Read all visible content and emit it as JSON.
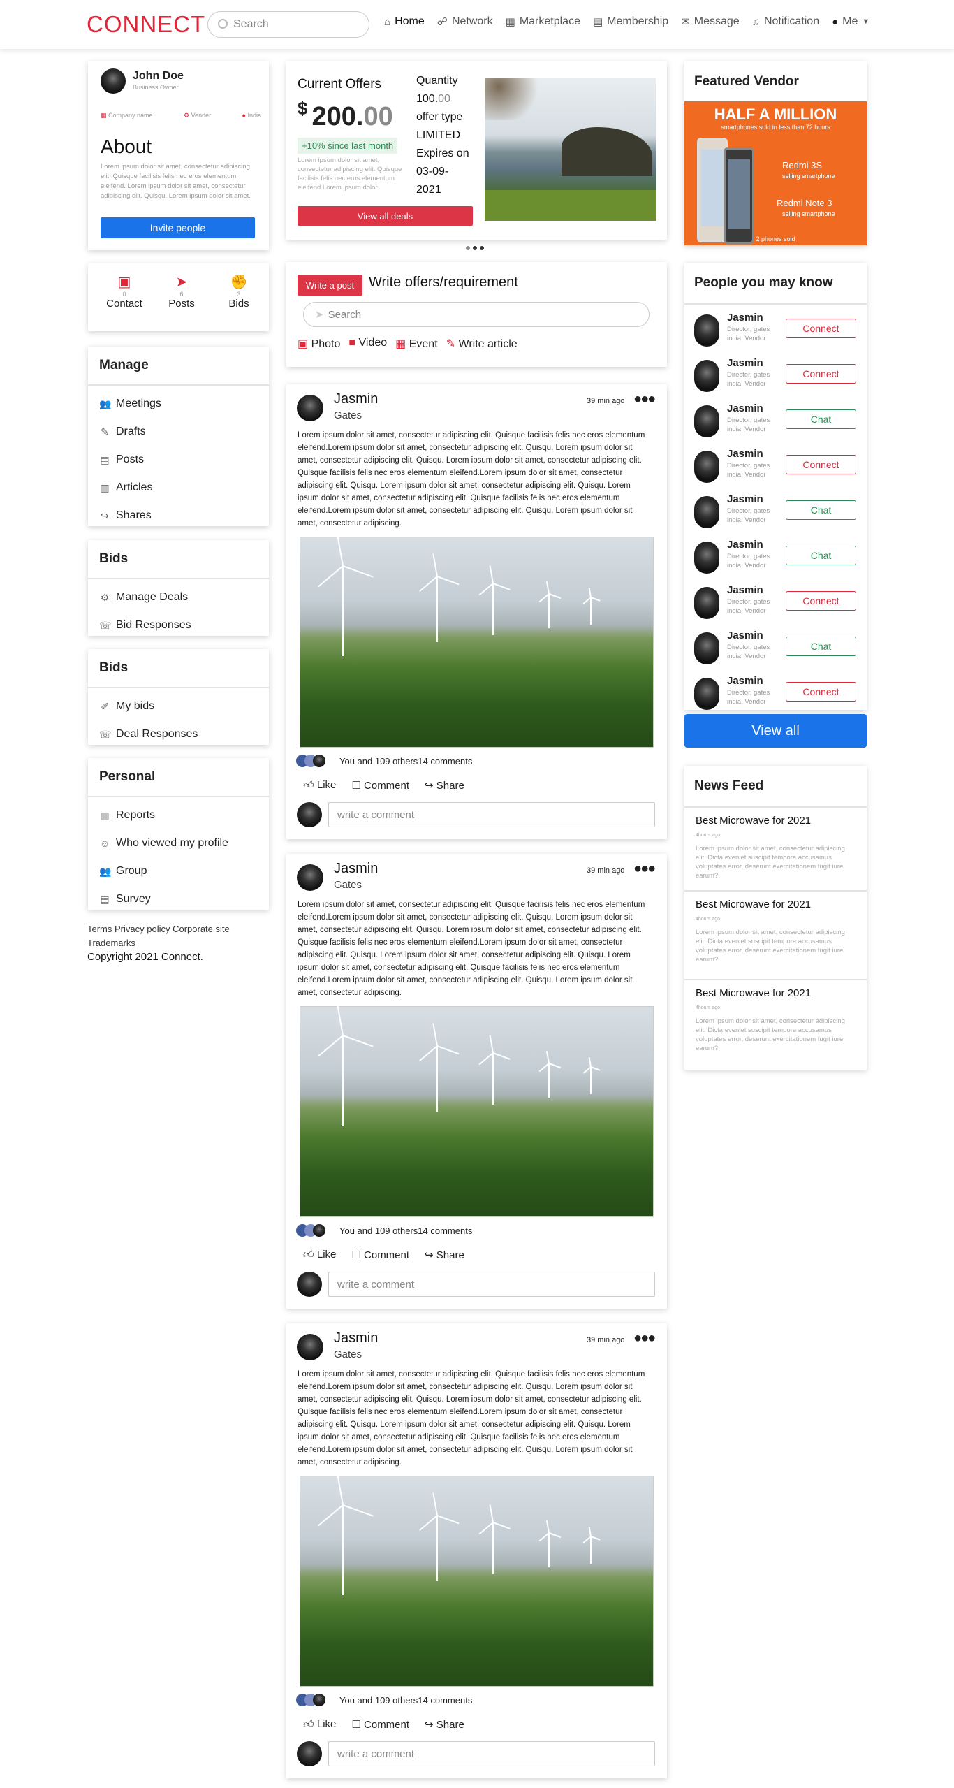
{
  "app": {
    "logo": "CONNECT",
    "search_placeholder": "Search"
  },
  "nav": [
    {
      "label": "Home",
      "icon": "home-icon",
      "glyph": "⌂"
    },
    {
      "label": "Network",
      "icon": "network-icon",
      "glyph": "☍"
    },
    {
      "label": "Marketplace",
      "icon": "marketplace-icon",
      "glyph": "▦"
    },
    {
      "label": "Membership",
      "icon": "membership-icon",
      "glyph": "▤"
    },
    {
      "label": "Message",
      "icon": "message-icon",
      "glyph": "✉"
    },
    {
      "label": "Notification",
      "icon": "bell-icon",
      "glyph": "♫"
    },
    {
      "label": "Me",
      "icon": "avatar-icon",
      "glyph": "●"
    }
  ],
  "profile": {
    "name": "John Doe",
    "role": "Business Owner",
    "meta": [
      "Company name",
      "Vender",
      "India"
    ],
    "about_title": "About",
    "about_text": "Lorem ipsum dolor sit amet, consectetur adipiscing elit. Quisque facilisis felis nec eros elementum eleifend. Lorem ipsum dolor sit amet, consectetur adipiscing elit. Quisqu. Lorem ipsum dolor sit amet.",
    "invite_label": "Invite people"
  },
  "stats": [
    {
      "count": "0",
      "label": "Contact"
    },
    {
      "count": "6",
      "label": "Posts"
    },
    {
      "count": "3",
      "label": "Bids"
    }
  ],
  "menus": [
    {
      "title": "Manage",
      "items": [
        {
          "label": "Meetings",
          "glyph": "👥"
        },
        {
          "label": "Drafts",
          "glyph": "✎"
        },
        {
          "label": "Posts",
          "glyph": "▤"
        },
        {
          "label": "Articles",
          "glyph": "▥"
        },
        {
          "label": "Shares",
          "glyph": "↪"
        }
      ]
    },
    {
      "title": "Bids",
      "items": [
        {
          "label": "Manage Deals",
          "glyph": "⚙"
        },
        {
          "label": "Bid Responses",
          "glyph": "☏"
        }
      ]
    },
    {
      "title": "Bids",
      "items": [
        {
          "label": "My bids",
          "glyph": "✐"
        },
        {
          "label": "Deal Responses",
          "glyph": "☏"
        }
      ]
    },
    {
      "title": "Personal",
      "items": [
        {
          "label": "Reports",
          "glyph": "▥"
        },
        {
          "label": "Who viewed my profile",
          "glyph": "☺"
        },
        {
          "label": "Group",
          "glyph": "👥"
        },
        {
          "label": "Survey",
          "glyph": "▤"
        }
      ]
    }
  ],
  "footer": {
    "links": "Terms Privacy policy Corporate site",
    "links2": "Trademarks",
    "copyright": "Copyright 2021 Connect."
  },
  "offers": {
    "title": "Current Offers",
    "currency": "$",
    "amount_main": "200.",
    "amount_cents": "00",
    "growth": "+10% since last month",
    "desc": "Lorem ipsum dolor sit amet, consectetur adipiscing elit. Quisque facilisis felis nec eros elementum eleifend.Lorem ipsum dolor",
    "button": "View all deals",
    "quantity_label": "Quantity",
    "quantity_main": "100.",
    "quantity_cents": "00",
    "offer_type_label": "offer type",
    "offer_type": "LIMITED",
    "expires_label": "Expires on",
    "expires": "03-09-2021"
  },
  "composer": {
    "write_post": "Write a post",
    "heading": "Write offers/requirement",
    "search_placeholder": "Search",
    "actions": [
      "Photo",
      "Video",
      "Event",
      "Write article"
    ]
  },
  "posts": [
    {
      "name": "Jasmin",
      "sub": "Gates",
      "time": "39 min ago",
      "reactions": "You and 109 others",
      "comments": "14 comments"
    },
    {
      "name": "Jasmin",
      "sub": "Gates",
      "time": "39 min ago",
      "reactions": "You and 109 others",
      "comments": "14 comments"
    },
    {
      "name": "Jasmin",
      "sub": "Gates",
      "time": "39 min ago",
      "reactions": "You and 109 others",
      "comments": "14 comments"
    }
  ],
  "post_body": "Lorem ipsum dolor sit amet, consectetur adipiscing elit. Quisque facilisis felis nec eros elementum eleifend.Lorem ipsum dolor sit amet, consectetur adipiscing elit. Quisqu. Lorem ipsum dolor sit amet, consectetur adipiscing elit. Quisqu. Lorem ipsum dolor sit amet, consectetur adipiscing elit. Quisque facilisis felis nec eros elementum eleifend.Lorem ipsum dolor sit amet, consectetur adipiscing elit. Quisqu. Lorem ipsum dolor sit amet, consectetur adipiscing elit. Quisqu. Lorem ipsum dolor sit amet, consectetur adipiscing elit. Quisque facilisis felis nec eros elementum eleifend.Lorem ipsum dolor sit amet, consectetur adipiscing elit. Quisqu. Lorem ipsum dolor sit amet, consectetur adipiscing.",
  "post_actions": {
    "like": "Like",
    "comment": "Comment",
    "share": "Share",
    "comment_placeholder": "write a comment"
  },
  "vendor": {
    "title": "Featured Vendor",
    "ad_headline": "HALF A MILLION",
    "ad_sub": "smartphones sold in less than 72 hours",
    "ad_model1": "Redmi 3S",
    "ad_line1": "selling smartphone",
    "ad_model2": "Redmi Note 3",
    "ad_line2": "selling smartphone",
    "ad_footer": "2 phones sold"
  },
  "people": {
    "title": "People you may know",
    "items": [
      {
        "name": "Jasmin",
        "desc": "Director, gates india, Vendor",
        "action": "Connect"
      },
      {
        "name": "Jasmin",
        "desc": "Director, gates india, Vendor",
        "action": "Connect"
      },
      {
        "name": "Jasmin",
        "desc": "Director, gates india, Vendor",
        "action": "Chat"
      },
      {
        "name": "Jasmin",
        "desc": "Director, gates india, Vendor",
        "action": "Connect"
      },
      {
        "name": "Jasmin",
        "desc": "Director, gates india, Vendor",
        "action": "Chat"
      },
      {
        "name": "Jasmin",
        "desc": "Director, gates india, Vendor",
        "action": "Chat"
      },
      {
        "name": "Jasmin",
        "desc": "Director, gates india, Vendor",
        "action": "Connect"
      },
      {
        "name": "Jasmin",
        "desc": "Director, gates india, Vendor",
        "action": "Chat"
      },
      {
        "name": "Jasmin",
        "desc": "Director, gates india, Vendor",
        "action": "Connect"
      }
    ],
    "view_all": "View all"
  },
  "news": {
    "title": "News Feed",
    "items": [
      {
        "title": "Best Microwave for 2021",
        "time": "4hours ago",
        "text": "Lorem ipsum dolor sit amet, consectetur adipiscing elit. Dicta eveniet suscipit tempore accusamus voluptates error, deserunt exercitationem fugit iure earum?"
      },
      {
        "title": "Best Microwave for 2021",
        "time": "4hours ago",
        "text": "Lorem ipsum dolor sit amet, consectetur adipiscing elit. Dicta eveniet suscipit tempore accusamus voluptates error, deserunt exercitationem fugit iure earum?"
      },
      {
        "title": "Best Microwave for 2021",
        "time": "4hours ago",
        "text": "Lorem ipsum dolor sit amet, consectetur adipiscing elit. Dicta eveniet suscipit tempore accusamus voluptates error, deserunt exercitationem fugit iure earum?"
      }
    ]
  },
  "colors": {
    "brand_red": "#e02639",
    "primary_blue": "#1a73e8",
    "chat_green": "#2e8b57"
  }
}
